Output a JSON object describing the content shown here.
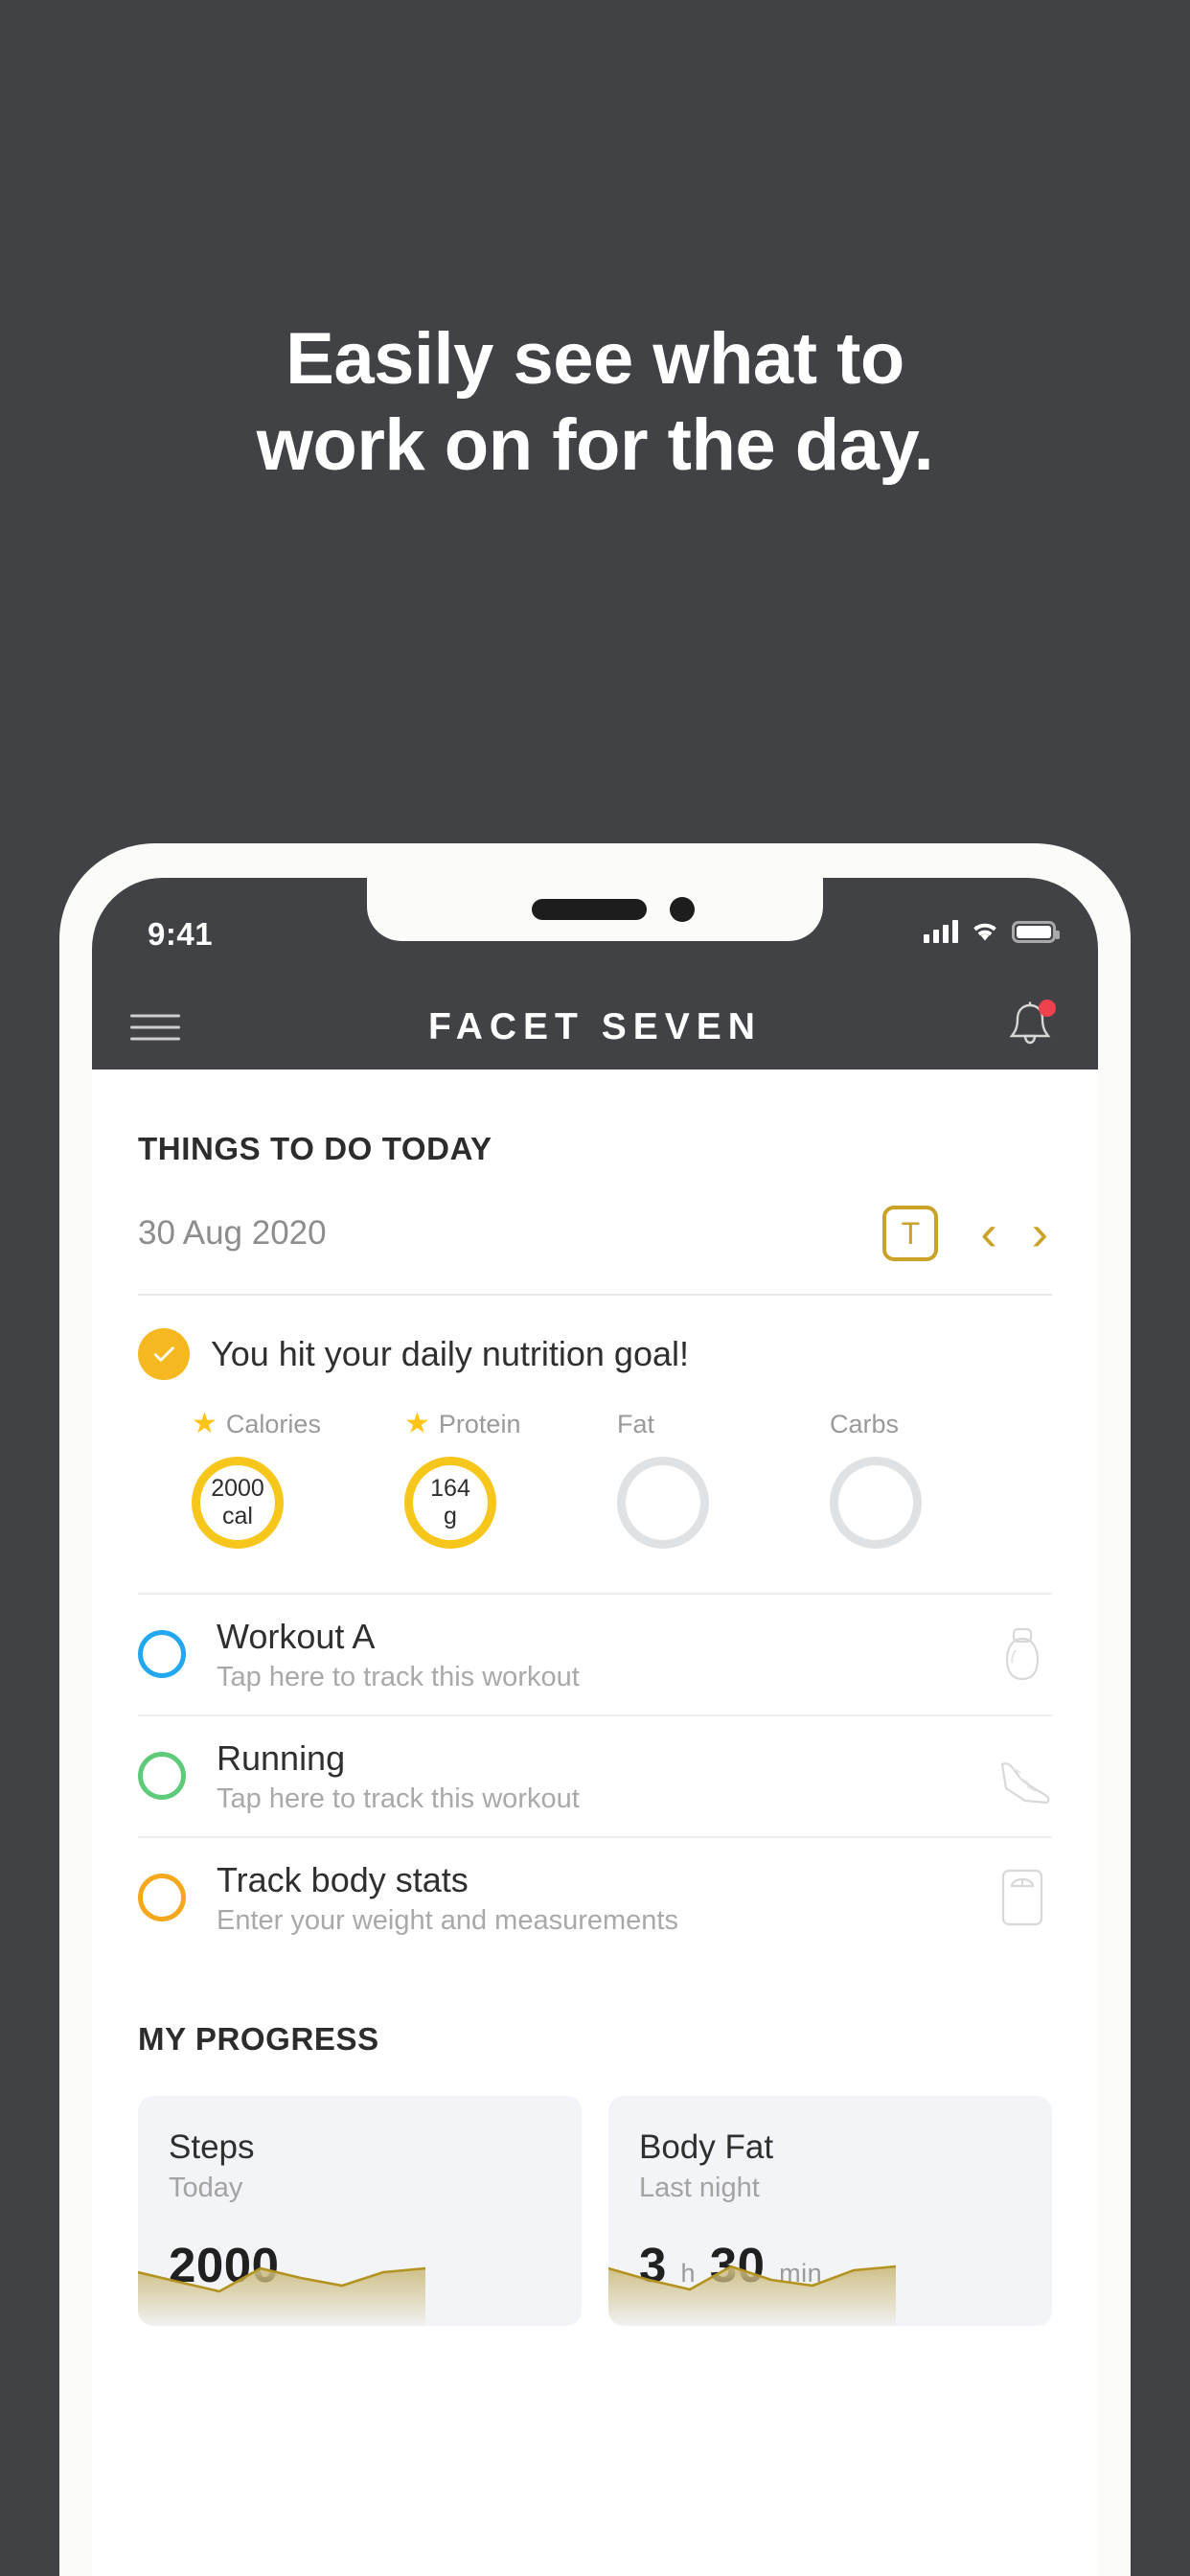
{
  "promo": {
    "headline_line1": "Easily see what to",
    "headline_line2": "work on for the day.",
    "background_color": "#414245"
  },
  "phone": {
    "status_bar": {
      "time": "9:41",
      "signal_icon": "cellular-signal-icon",
      "wifi_icon": "wifi-icon",
      "battery_icon": "battery-icon"
    },
    "app_header": {
      "menu_icon": "hamburger-menu-icon",
      "title": "FACET SEVEN",
      "notification_icon": "bell-icon",
      "notification_badge": true
    }
  },
  "todo": {
    "section_title": "THINGS TO DO TODAY",
    "date": "30 Aug 2020",
    "today_button_label": "T",
    "prev_label": "‹",
    "next_label": "›",
    "accent_color": "#c9a227"
  },
  "nutrition": {
    "message": "You hit your daily nutrition goal!",
    "check_icon": "check-icon",
    "metrics": [
      {
        "label": "Calories",
        "starred": true,
        "value": "2000",
        "unit": "cal",
        "complete": true
      },
      {
        "label": "Protein",
        "starred": true,
        "value": "164",
        "unit": "g",
        "complete": true
      },
      {
        "label": "Fat",
        "starred": false,
        "value": "",
        "unit": "",
        "complete": false
      },
      {
        "label": "Carbs",
        "starred": false,
        "value": "",
        "unit": "",
        "complete": false
      }
    ],
    "gold_color": "#f7c61a",
    "empty_color": "#dfe2e4"
  },
  "tasks": [
    {
      "title": "Workout A",
      "subtitle": "Tap here to track this workout",
      "circle_color": "#22a7f0",
      "icon": "kettlebell-icon"
    },
    {
      "title": "Running",
      "subtitle": "Tap here to track this workout",
      "circle_color": "#5ecb7a",
      "icon": "running-shoe-icon"
    },
    {
      "title": "Track body stats",
      "subtitle": "Enter your weight and measurements",
      "circle_color": "#f5a81c",
      "icon": "weight-scale-icon"
    }
  ],
  "progress": {
    "section_title": "MY PROGRESS",
    "cards": [
      {
        "title": "Steps",
        "subtitle": "Today",
        "value": "2000",
        "unit": ""
      },
      {
        "title": "Body Fat",
        "subtitle": "Last night",
        "value": "3",
        "unit": "h",
        "value2": "30",
        "unit2": "min"
      }
    ]
  },
  "chart_data": [
    {
      "type": "area",
      "title": "Steps",
      "x": [
        0,
        1,
        2,
        3,
        4,
        5,
        6,
        7
      ],
      "values": [
        55,
        48,
        40,
        52,
        66,
        58,
        50,
        62
      ],
      "line_color": "#b59320",
      "fill_color": "#c9b877",
      "ylim": [
        0,
        100
      ],
      "grid": false,
      "legend": "none"
    },
    {
      "type": "area",
      "title": "Body Fat",
      "x": [
        0,
        1,
        2,
        3,
        4,
        5,
        6,
        7
      ],
      "values": [
        58,
        50,
        42,
        56,
        68,
        56,
        48,
        64
      ],
      "line_color": "#b59320",
      "fill_color": "#c9b877",
      "ylim": [
        0,
        100
      ],
      "grid": false,
      "legend": "none"
    }
  ]
}
